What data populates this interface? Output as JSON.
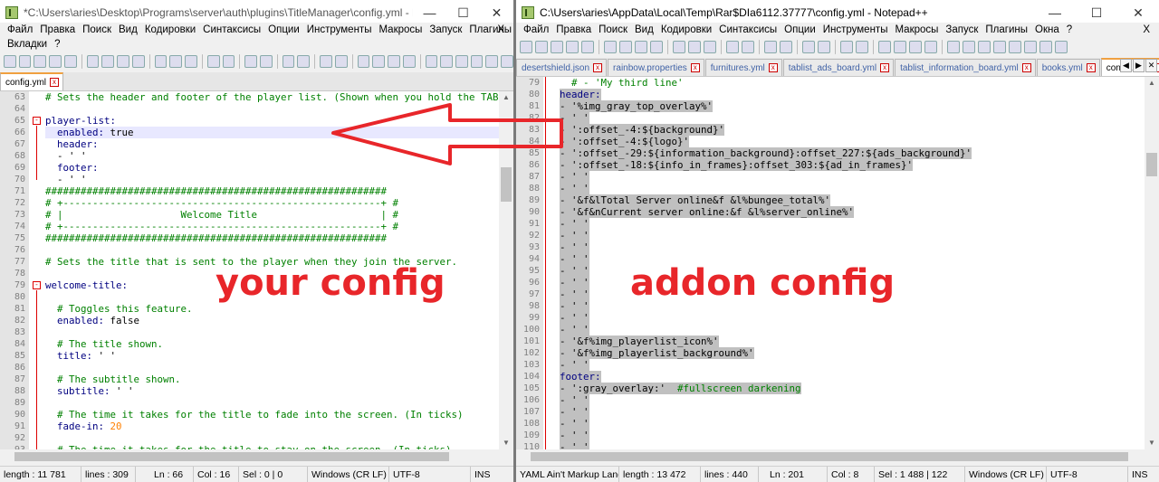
{
  "left": {
    "title": "*C:\\Users\\aries\\Desktop\\Programs\\server\\auth\\plugins\\TitleManager\\config.yml - Notepad++",
    "menu_row1": [
      "Файл",
      "Правка",
      "Поиск",
      "Вид",
      "Кодировки",
      "Синтаксисы",
      "Опции",
      "Инструменты",
      "Макросы",
      "Запуск",
      "Плагины"
    ],
    "menu_row2": [
      "Вкладки",
      "?"
    ],
    "menu_close": "X",
    "tab": "config.yml",
    "lines": [
      {
        "n": "63",
        "t": "# Sets the header and footer of the player list. (Shown when you hold the TAB",
        "c": "com"
      },
      {
        "n": "64",
        "t": "",
        "c": ""
      },
      {
        "n": "65",
        "t": "player-list:",
        "c": "key"
      },
      {
        "n": "66",
        "t": "  enabled: true",
        "c": "kv",
        "cur": true
      },
      {
        "n": "67",
        "t": "  header:",
        "c": "key"
      },
      {
        "n": "68",
        "t": "  - ' '",
        "c": ""
      },
      {
        "n": "69",
        "t": "  footer:",
        "c": "key"
      },
      {
        "n": "70",
        "t": "  - ' '",
        "c": ""
      },
      {
        "n": "71",
        "t": "##########################################################",
        "c": "com"
      },
      {
        "n": "72",
        "t": "# +------------------------------------------------------+ #",
        "c": "com"
      },
      {
        "n": "73",
        "t": "# |                    Welcome Title                     | #",
        "c": "com"
      },
      {
        "n": "74",
        "t": "# +------------------------------------------------------+ #",
        "c": "com"
      },
      {
        "n": "75",
        "t": "##########################################################",
        "c": "com"
      },
      {
        "n": "76",
        "t": "",
        "c": ""
      },
      {
        "n": "77",
        "t": "# Sets the title that is sent to the player when they join the server.",
        "c": "com"
      },
      {
        "n": "78",
        "t": "",
        "c": ""
      },
      {
        "n": "79",
        "t": "welcome-title:",
        "c": "key"
      },
      {
        "n": "80",
        "t": "",
        "c": ""
      },
      {
        "n": "81",
        "t": "  # Toggles this feature.",
        "c": "com"
      },
      {
        "n": "82",
        "t": "  enabled: false",
        "c": "kv"
      },
      {
        "n": "83",
        "t": "",
        "c": ""
      },
      {
        "n": "84",
        "t": "  # The title shown.",
        "c": "com"
      },
      {
        "n": "85",
        "t": "  title: ' '",
        "c": "kv"
      },
      {
        "n": "86",
        "t": "",
        "c": ""
      },
      {
        "n": "87",
        "t": "  # The subtitle shown.",
        "c": "com"
      },
      {
        "n": "88",
        "t": "  subtitle: ' '",
        "c": "kv"
      },
      {
        "n": "89",
        "t": "",
        "c": ""
      },
      {
        "n": "90",
        "t": "  # The time it takes for the title to fade into the screen. (In ticks)",
        "c": "com"
      },
      {
        "n": "91",
        "t": "  fade-in: 20",
        "c": "num"
      },
      {
        "n": "92",
        "t": "",
        "c": ""
      },
      {
        "n": "93",
        "t": "  # The time it takes for the title to stay on the screen. (In ticks)",
        "c": "com"
      }
    ],
    "status": {
      "length": "length : 11 781",
      "lines": "lines : 309",
      "ln": "Ln : 66",
      "col": "Col : 16",
      "sel": "Sel : 0 | 0",
      "eol": "Windows (CR LF)",
      "enc": "UTF-8",
      "ins": "INS"
    },
    "overlay": "your config"
  },
  "right": {
    "title": "C:\\Users\\aries\\AppData\\Local\\Temp\\Rar$DIa6112.37777\\config.yml - Notepad++",
    "menu_row1": [
      "Файл",
      "Правка",
      "Поиск",
      "Вид",
      "Кодировки",
      "Синтаксисы",
      "Опции",
      "Инструменты",
      "Макросы",
      "Запуск",
      "Плагины",
      "Окна",
      "?"
    ],
    "menu_close": "X",
    "tabs": [
      "desertshield.json",
      "rainbow.properties",
      "furnitures.yml",
      "tablist_ads_board.yml",
      "tablist_information_board.yml",
      "books.yml",
      "config.yml"
    ],
    "lines": [
      {
        "n": "79",
        "t": "  # - 'My third line'",
        "c": "com"
      },
      {
        "n": "80",
        "t": "header:",
        "c": "key",
        "s": true
      },
      {
        "n": "81",
        "t": "- '%img_gray_top_overlay%'",
        "c": "",
        "s": true
      },
      {
        "n": "82",
        "t": "- ' '",
        "c": "",
        "s": true
      },
      {
        "n": "83",
        "t": "- ':offset_-4:${background}'",
        "c": "",
        "s": true
      },
      {
        "n": "84",
        "t": "- ':offset_-4:${logo}'",
        "c": "",
        "s": true
      },
      {
        "n": "85",
        "t": "- ':offset_-29:${information_background}:offset_227:${ads_background}'",
        "c": "",
        "s": true
      },
      {
        "n": "86",
        "t": "- ':offset_-18:${info_in_frames}:offset_303:${ad_in_frames}'",
        "c": "",
        "s": true
      },
      {
        "n": "87",
        "t": "- ' '",
        "c": "",
        "s": true
      },
      {
        "n": "88",
        "t": "- ' '",
        "c": "",
        "s": true
      },
      {
        "n": "89",
        "t": "- '&f&lTotal Server online&f &l%bungee_total%'",
        "c": "",
        "s": true
      },
      {
        "n": "90",
        "t": "- '&f&nCurrent server online:&f &l%server_online%'",
        "c": "",
        "s": true
      },
      {
        "n": "91",
        "t": "- ' '",
        "c": "",
        "s": true
      },
      {
        "n": "92",
        "t": "- ' '",
        "c": "",
        "s": true
      },
      {
        "n": "93",
        "t": "- ' '",
        "c": "",
        "s": true
      },
      {
        "n": "94",
        "t": "- ' '",
        "c": "",
        "s": true
      },
      {
        "n": "95",
        "t": "- ' '",
        "c": "",
        "s": true
      },
      {
        "n": "96",
        "t": "- ' '",
        "c": "",
        "s": true
      },
      {
        "n": "97",
        "t": "- ' '",
        "c": "",
        "s": true
      },
      {
        "n": "98",
        "t": "- ' '",
        "c": "",
        "s": true
      },
      {
        "n": "99",
        "t": "- ' '",
        "c": "",
        "s": true
      },
      {
        "n": "100",
        "t": "- ' '",
        "c": "",
        "s": true
      },
      {
        "n": "101",
        "t": "- '&f%img_playerlist_icon%'",
        "c": "",
        "s": true
      },
      {
        "n": "102",
        "t": "- '&f%img_playerlist_background%'",
        "c": "",
        "s": true
      },
      {
        "n": "103",
        "t": "- ' '",
        "c": "",
        "s": true
      },
      {
        "n": "104",
        "t": "footer:",
        "c": "key",
        "s": true
      },
      {
        "n": "105",
        "t": "- ':gray_overlay:'  #fullscreen darkening",
        "c": "mixcom",
        "s": true
      },
      {
        "n": "106",
        "t": "- ' '",
        "c": "",
        "s": true
      },
      {
        "n": "107",
        "t": "- ' '",
        "c": "",
        "s": true
      },
      {
        "n": "108",
        "t": "- ' '",
        "c": "",
        "s": true
      },
      {
        "n": "109",
        "t": "- ' '",
        "c": "",
        "s": true
      },
      {
        "n": "110",
        "t": "- ' '",
        "c": "",
        "s": true
      }
    ],
    "status": {
      "lang": "YAML Ain't Markup Lang",
      "length": "length : 13 472",
      "lines": "lines : 440",
      "ln": "Ln : 201",
      "col": "Col : 8",
      "sel": "Sel : 1 488 | 122",
      "eol": "Windows (CR LF)",
      "enc": "UTF-8",
      "ins": "INS"
    },
    "overlay": "addon config"
  },
  "colors": {
    "arrow": "#e8262a",
    "selection": "#c0c0c0",
    "comment": "#008000",
    "keyword": "#000080"
  },
  "icons": [
    "notepad-icon",
    "minimize-icon",
    "maximize-icon",
    "close-icon"
  ]
}
